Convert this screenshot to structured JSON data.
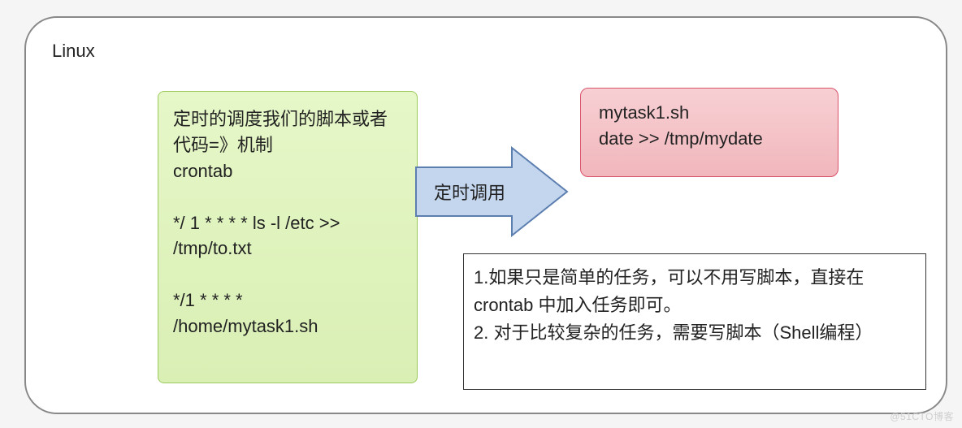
{
  "panel": {
    "title": "Linux"
  },
  "green": {
    "line1": "定时的调度我们的脚本或者代码=》机制",
    "line2": "crontab",
    "line3": "*/ 1 * * * * ls -l /etc >>",
    "line4": "/tmp/to.txt",
    "line5": "*/1 * * * *",
    "line6": "/home/mytask1.sh"
  },
  "arrow": {
    "label": "定时调用",
    "fill": "#c3d6ee",
    "stroke": "#5c7fb0"
  },
  "red": {
    "line1": "mytask1.sh",
    "line2": "date >> /tmp/mydate"
  },
  "notes": {
    "n1": "1.如果只是简单的任务，可以不用写脚本，直接在crontab 中加入任务即可。",
    "n2": "2. 对于比较复杂的任务，需要写脚本（Shell编程）"
  },
  "watermark": "@51CTO博客"
}
